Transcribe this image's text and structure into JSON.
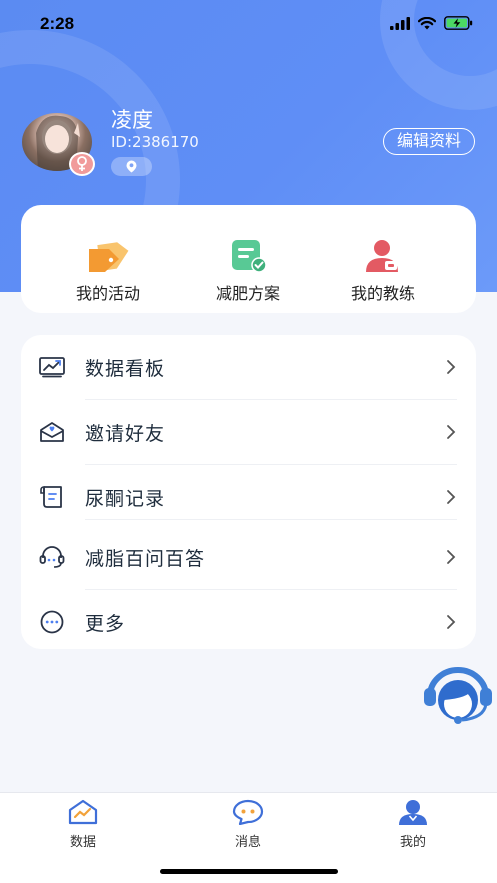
{
  "status_bar": {
    "time": "2:28"
  },
  "profile": {
    "name": "凌度",
    "id_text": "ID:2386170",
    "edit_button": "编辑资料"
  },
  "quick_actions": [
    {
      "label": "我的活动",
      "icon": "tag-icon"
    },
    {
      "label": "减肥方案",
      "icon": "plan-document-icon"
    },
    {
      "label": "我的教练",
      "icon": "coach-icon"
    }
  ],
  "menu": [
    {
      "label": "数据看板",
      "icon": "chart-board-icon"
    },
    {
      "label": "邀请好友",
      "icon": "invite-envelope-icon"
    },
    {
      "label": "尿酮记录",
      "icon": "record-scroll-icon"
    },
    {
      "label": "减脂百问百答",
      "icon": "headset-icon"
    },
    {
      "label": "更多",
      "icon": "more-dots-icon"
    }
  ],
  "tabbar": [
    {
      "label": "数据",
      "icon": "home-chart-icon",
      "active": false
    },
    {
      "label": "消息",
      "icon": "chat-bubble-icon",
      "active": false
    },
    {
      "label": "我的",
      "icon": "profile-icon",
      "active": true
    }
  ],
  "colors": {
    "primary": "#5b8bf2",
    "tab_active": "#3f6fd8",
    "tag_orange": "#f6a33c",
    "plan_green": "#4fc28c",
    "coach_red": "#e0525d"
  }
}
